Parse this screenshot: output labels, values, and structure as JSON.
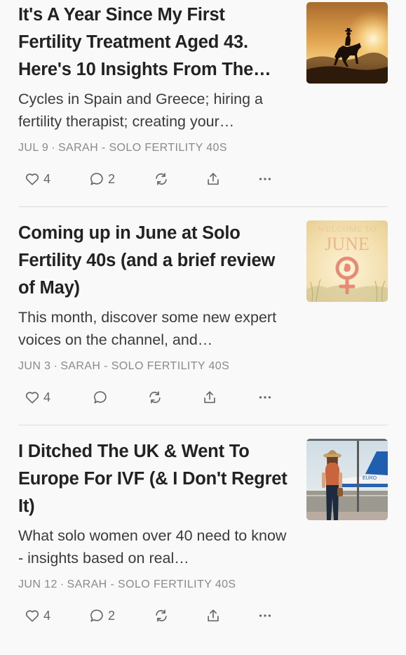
{
  "posts": [
    {
      "title": "It's A Year Since My First Fertility Treatment Aged 43. Here's 10 Insights From The…",
      "subtitle": "Cycles in Spain and Greece; hiring a fertility therapist; creating your…",
      "date": "JUL 9",
      "author": "SARAH - SOLO FERTILITY 40S",
      "likes": "4",
      "comments": "2",
      "thumbnail_icon": "cowboy-sunset-image"
    },
    {
      "title": "Coming up in June at Solo Fertility 40s (and a brief review of May)",
      "subtitle": "This month, discover some new expert voices on the channel, and…",
      "date": "JUN 3",
      "author": "SARAH - SOLO FERTILITY 40S",
      "likes": "4",
      "comments": "",
      "thumbnail_icon": "welcome-to-june-image",
      "thumbnail_text": {
        "line1": "WELCOME TO",
        "line2": "JUNE"
      }
    },
    {
      "title": "I Ditched The UK & Went To Europe For IVF (& I Don't Regret It)",
      "subtitle": "What solo women over 40 need to know - insights based on real…",
      "date": "JUN 12",
      "author": "SARAH - SOLO FERTILITY 40S",
      "likes": "4",
      "comments": "2",
      "thumbnail_icon": "airport-traveler-image",
      "thumbnail_text": {
        "plane": "EURO"
      }
    }
  ],
  "meta_separator": "·",
  "icons": [
    "heart-icon",
    "comment-icon",
    "restack-icon",
    "share-icon",
    "more-icon"
  ],
  "colors": {
    "background": "#f9f9f9",
    "title": "#222222",
    "meta": "#8a8a8a",
    "icon": "#666666"
  }
}
